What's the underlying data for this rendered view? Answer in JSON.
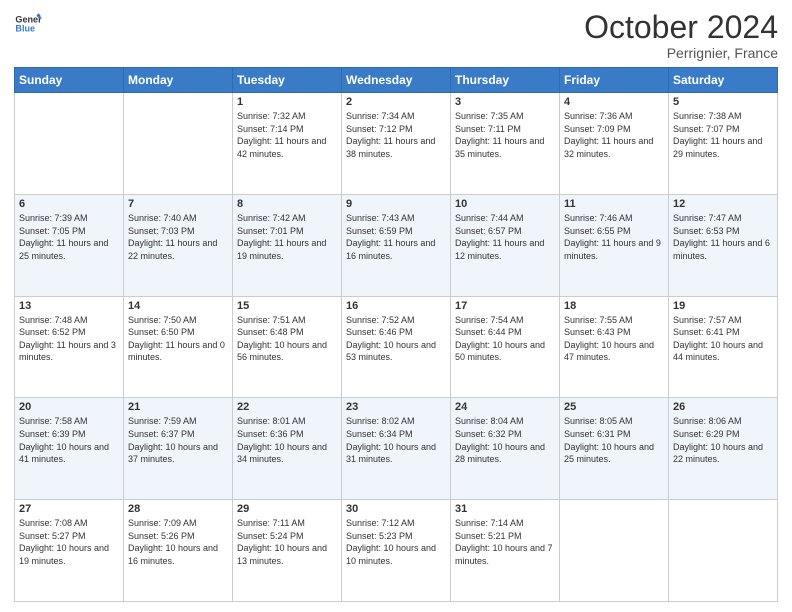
{
  "header": {
    "logo_line1": "General",
    "logo_line2": "Blue",
    "month": "October 2024",
    "location": "Perrignier, France"
  },
  "days_of_week": [
    "Sunday",
    "Monday",
    "Tuesday",
    "Wednesday",
    "Thursday",
    "Friday",
    "Saturday"
  ],
  "weeks": [
    [
      {
        "day": "",
        "info": ""
      },
      {
        "day": "",
        "info": ""
      },
      {
        "day": "1",
        "info": "Sunrise: 7:32 AM\nSunset: 7:14 PM\nDaylight: 11 hours and 42 minutes."
      },
      {
        "day": "2",
        "info": "Sunrise: 7:34 AM\nSunset: 7:12 PM\nDaylight: 11 hours and 38 minutes."
      },
      {
        "day": "3",
        "info": "Sunrise: 7:35 AM\nSunset: 7:11 PM\nDaylight: 11 hours and 35 minutes."
      },
      {
        "day": "4",
        "info": "Sunrise: 7:36 AM\nSunset: 7:09 PM\nDaylight: 11 hours and 32 minutes."
      },
      {
        "day": "5",
        "info": "Sunrise: 7:38 AM\nSunset: 7:07 PM\nDaylight: 11 hours and 29 minutes."
      }
    ],
    [
      {
        "day": "6",
        "info": "Sunrise: 7:39 AM\nSunset: 7:05 PM\nDaylight: 11 hours and 25 minutes."
      },
      {
        "day": "7",
        "info": "Sunrise: 7:40 AM\nSunset: 7:03 PM\nDaylight: 11 hours and 22 minutes."
      },
      {
        "day": "8",
        "info": "Sunrise: 7:42 AM\nSunset: 7:01 PM\nDaylight: 11 hours and 19 minutes."
      },
      {
        "day": "9",
        "info": "Sunrise: 7:43 AM\nSunset: 6:59 PM\nDaylight: 11 hours and 16 minutes."
      },
      {
        "day": "10",
        "info": "Sunrise: 7:44 AM\nSunset: 6:57 PM\nDaylight: 11 hours and 12 minutes."
      },
      {
        "day": "11",
        "info": "Sunrise: 7:46 AM\nSunset: 6:55 PM\nDaylight: 11 hours and 9 minutes."
      },
      {
        "day": "12",
        "info": "Sunrise: 7:47 AM\nSunset: 6:53 PM\nDaylight: 11 hours and 6 minutes."
      }
    ],
    [
      {
        "day": "13",
        "info": "Sunrise: 7:48 AM\nSunset: 6:52 PM\nDaylight: 11 hours and 3 minutes."
      },
      {
        "day": "14",
        "info": "Sunrise: 7:50 AM\nSunset: 6:50 PM\nDaylight: 11 hours and 0 minutes."
      },
      {
        "day": "15",
        "info": "Sunrise: 7:51 AM\nSunset: 6:48 PM\nDaylight: 10 hours and 56 minutes."
      },
      {
        "day": "16",
        "info": "Sunrise: 7:52 AM\nSunset: 6:46 PM\nDaylight: 10 hours and 53 minutes."
      },
      {
        "day": "17",
        "info": "Sunrise: 7:54 AM\nSunset: 6:44 PM\nDaylight: 10 hours and 50 minutes."
      },
      {
        "day": "18",
        "info": "Sunrise: 7:55 AM\nSunset: 6:43 PM\nDaylight: 10 hours and 47 minutes."
      },
      {
        "day": "19",
        "info": "Sunrise: 7:57 AM\nSunset: 6:41 PM\nDaylight: 10 hours and 44 minutes."
      }
    ],
    [
      {
        "day": "20",
        "info": "Sunrise: 7:58 AM\nSunset: 6:39 PM\nDaylight: 10 hours and 41 minutes."
      },
      {
        "day": "21",
        "info": "Sunrise: 7:59 AM\nSunset: 6:37 PM\nDaylight: 10 hours and 37 minutes."
      },
      {
        "day": "22",
        "info": "Sunrise: 8:01 AM\nSunset: 6:36 PM\nDaylight: 10 hours and 34 minutes."
      },
      {
        "day": "23",
        "info": "Sunrise: 8:02 AM\nSunset: 6:34 PM\nDaylight: 10 hours and 31 minutes."
      },
      {
        "day": "24",
        "info": "Sunrise: 8:04 AM\nSunset: 6:32 PM\nDaylight: 10 hours and 28 minutes."
      },
      {
        "day": "25",
        "info": "Sunrise: 8:05 AM\nSunset: 6:31 PM\nDaylight: 10 hours and 25 minutes."
      },
      {
        "day": "26",
        "info": "Sunrise: 8:06 AM\nSunset: 6:29 PM\nDaylight: 10 hours and 22 minutes."
      }
    ],
    [
      {
        "day": "27",
        "info": "Sunrise: 7:08 AM\nSunset: 5:27 PM\nDaylight: 10 hours and 19 minutes."
      },
      {
        "day": "28",
        "info": "Sunrise: 7:09 AM\nSunset: 5:26 PM\nDaylight: 10 hours and 16 minutes."
      },
      {
        "day": "29",
        "info": "Sunrise: 7:11 AM\nSunset: 5:24 PM\nDaylight: 10 hours and 13 minutes."
      },
      {
        "day": "30",
        "info": "Sunrise: 7:12 AM\nSunset: 5:23 PM\nDaylight: 10 hours and 10 minutes."
      },
      {
        "day": "31",
        "info": "Sunrise: 7:14 AM\nSunset: 5:21 PM\nDaylight: 10 hours and 7 minutes."
      },
      {
        "day": "",
        "info": ""
      },
      {
        "day": "",
        "info": ""
      }
    ]
  ]
}
